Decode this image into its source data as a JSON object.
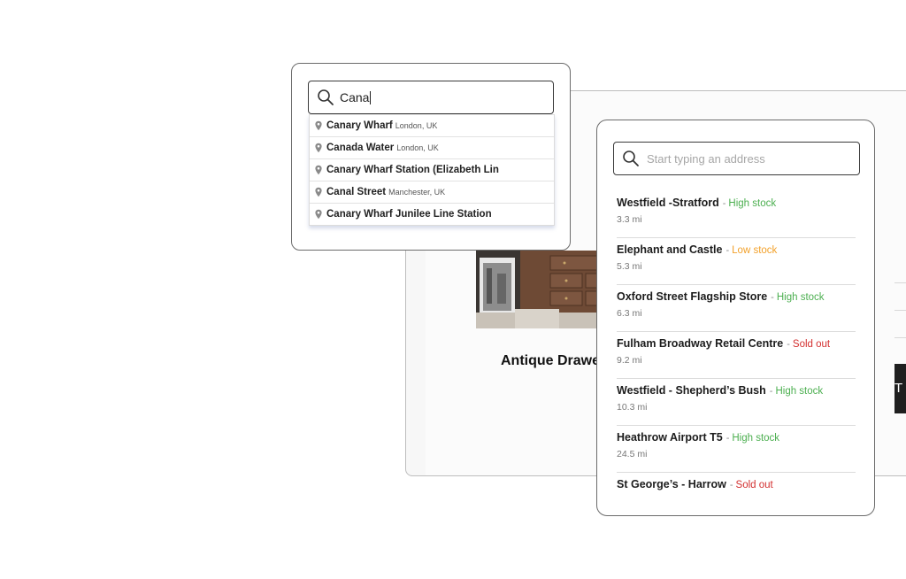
{
  "product": {
    "title": "Antique Drawer",
    "button_label": "T NO"
  },
  "autocomplete": {
    "query": "Cana",
    "suggestions": [
      {
        "name": "Canary Wharf",
        "region": "London, UK"
      },
      {
        "name": "Canada Water",
        "region": "London, UK"
      },
      {
        "name": "Canary Wharf Station (Elizabeth Lin",
        "region": ""
      },
      {
        "name": "Canal Street",
        "region": "Manchester, UK"
      },
      {
        "name": "Canary Wharf Junilee Line Station",
        "region": ""
      }
    ]
  },
  "store_finder": {
    "placeholder": "Start typing an address",
    "stores": [
      {
        "name": "Westfield -Stratford",
        "stock": "High stock",
        "stock_color": "#4caf50",
        "distance": "3.3 mi"
      },
      {
        "name": "Elephant and Castle",
        "stock": "Low stock",
        "stock_color": "#f2a12b",
        "distance": "5.3 mi"
      },
      {
        "name": "Oxford Street Flagship Store",
        "stock": "High stock",
        "stock_color": "#4caf50",
        "distance": "6.3 mi"
      },
      {
        "name": "Fulham Broadway Retail Centre",
        "stock": "Sold out",
        "stock_color": "#d32f2f",
        "distance": "9.2 mi"
      },
      {
        "name": "Westfield - Shepherd’s Bush",
        "stock": "High stock",
        "stock_color": "#4caf50",
        "distance": "10.3 mi"
      },
      {
        "name": "Heathrow Airport T5",
        "stock": "High stock",
        "stock_color": "#4caf50",
        "distance": "24.5 mi"
      },
      {
        "name": "St George’s - Harrow",
        "stock": "Sold out",
        "stock_color": "#d32f2f",
        "distance": ""
      }
    ]
  },
  "icons": {
    "search": "search-icon",
    "pin": "map-pin-icon"
  }
}
